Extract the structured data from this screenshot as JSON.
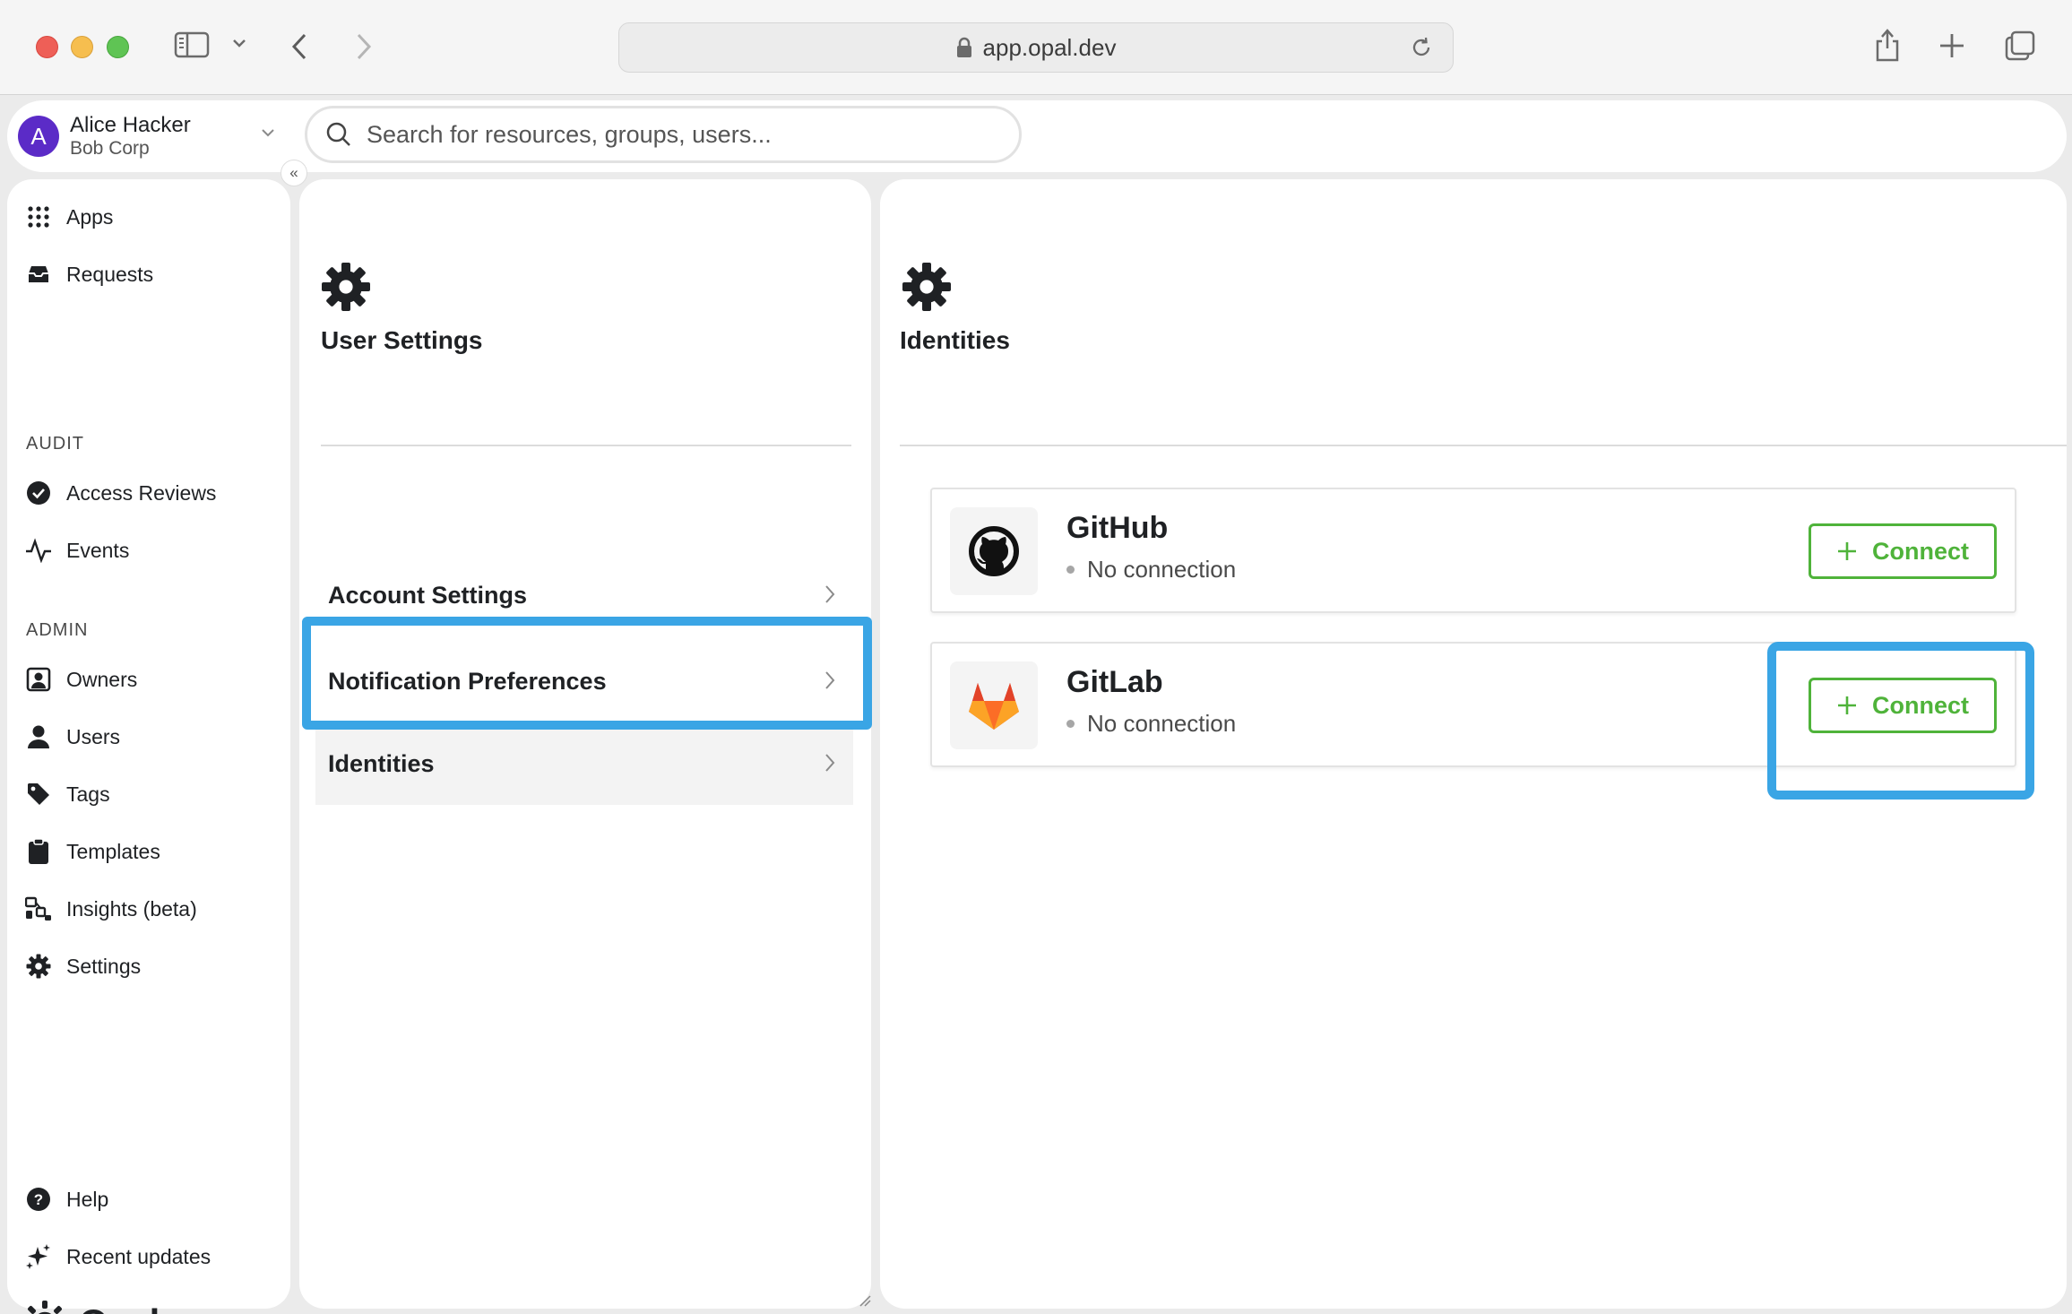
{
  "browser": {
    "url": "app.opal.dev"
  },
  "account": {
    "avatar_letter": "A",
    "name": "Alice Hacker",
    "org": "Bob Corp"
  },
  "search": {
    "placeholder": "Search for resources, groups, users..."
  },
  "collapse_label": "«",
  "sidebar": {
    "top_items": [
      {
        "label": "Apps",
        "icon": "grid-icon"
      },
      {
        "label": "Requests",
        "icon": "inbox-icon"
      }
    ],
    "audit_heading": "AUDIT",
    "audit_items": [
      {
        "label": "Access Reviews",
        "icon": "check-circle-icon"
      },
      {
        "label": "Events",
        "icon": "activity-icon"
      }
    ],
    "admin_heading": "ADMIN",
    "admin_items": [
      {
        "label": "Owners",
        "icon": "owner-icon"
      },
      {
        "label": "Users",
        "icon": "user-icon"
      },
      {
        "label": "Tags",
        "icon": "tag-icon"
      },
      {
        "label": "Templates",
        "icon": "clipboard-icon"
      },
      {
        "label": "Insights (beta)",
        "icon": "insights-icon"
      },
      {
        "label": "Settings",
        "icon": "gear-icon"
      }
    ],
    "bottom_items": [
      {
        "label": "Help",
        "icon": "help-icon"
      },
      {
        "label": "Recent updates",
        "icon": "sparkle-icon"
      }
    ],
    "logo_text": "Opal"
  },
  "user_settings": {
    "title": "User Settings",
    "rows": [
      {
        "label": "Account Settings"
      },
      {
        "label": "Notification Preferences"
      },
      {
        "label": "Identities",
        "active": true
      }
    ]
  },
  "identities": {
    "title": "Identities",
    "cards": [
      {
        "name": "GitHub",
        "status": "No connection",
        "button": "Connect",
        "icon": "github-icon"
      },
      {
        "name": "GitLab",
        "status": "No connection",
        "button": "Connect",
        "icon": "gitlab-icon"
      }
    ]
  },
  "colors": {
    "accent_green": "#4fb33a",
    "highlight_blue": "#3aa5e5",
    "avatar_purple": "#5b2bc7"
  }
}
